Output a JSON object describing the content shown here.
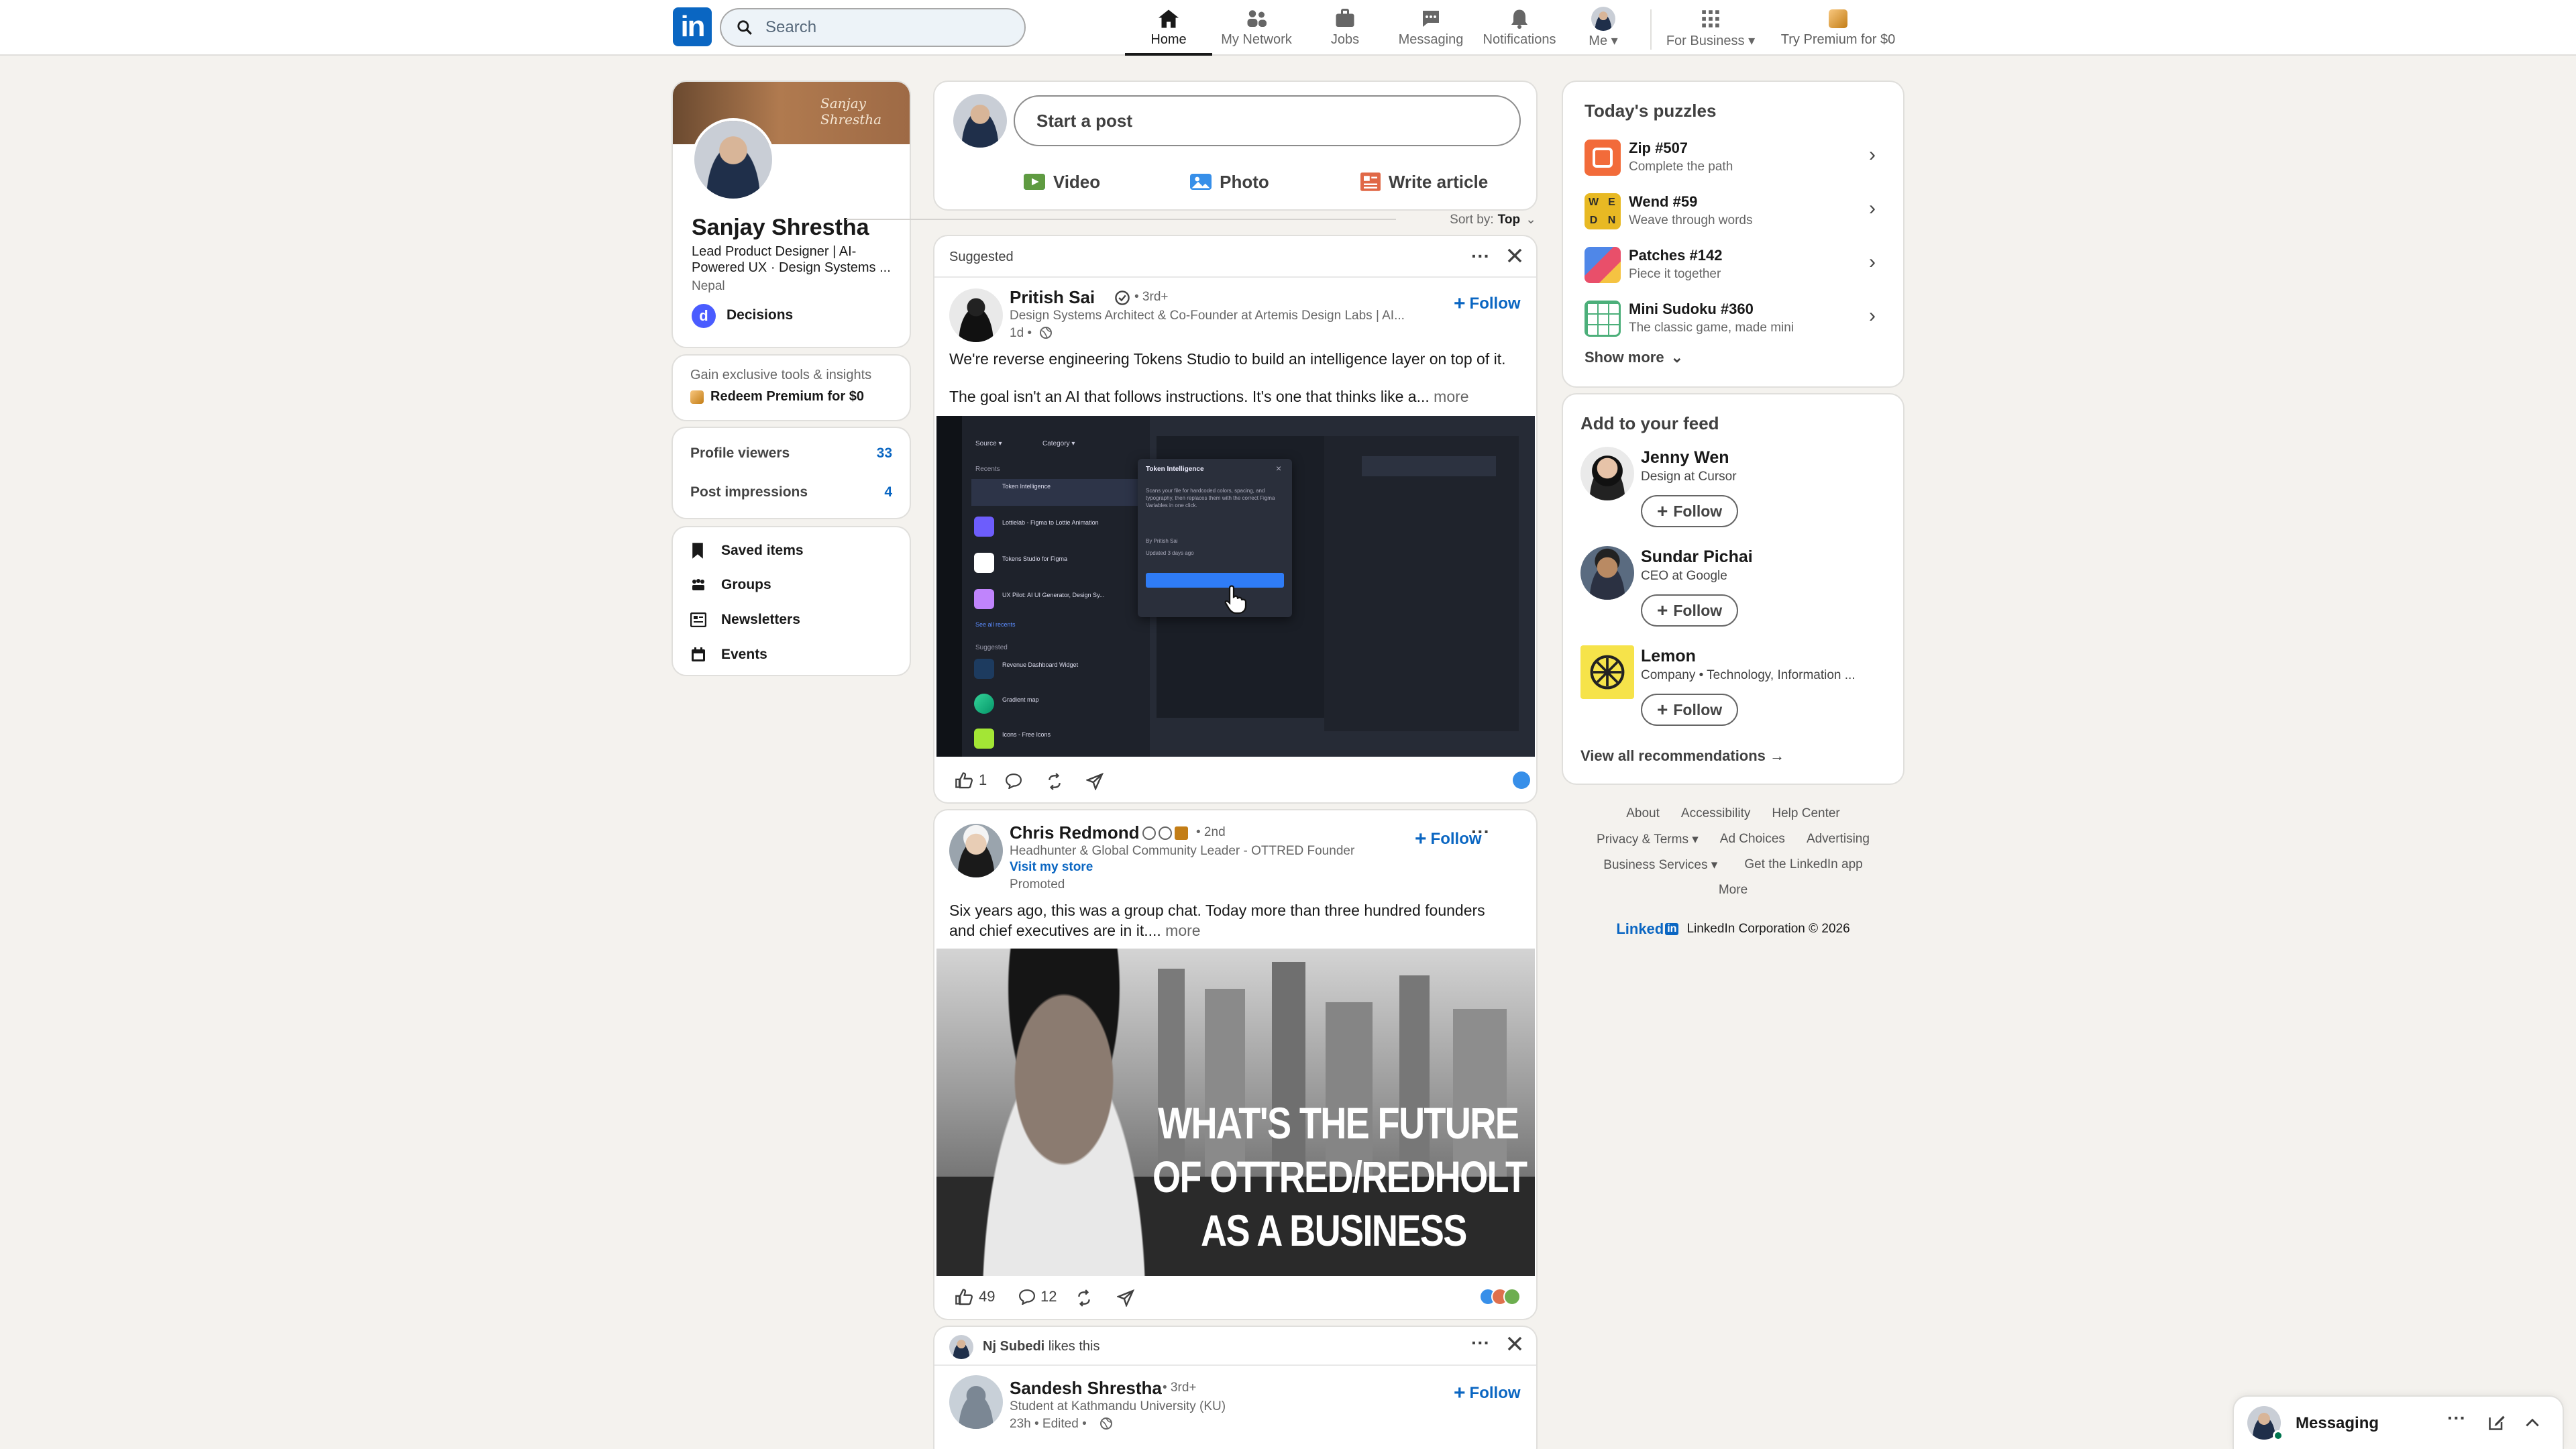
{
  "nav": {
    "logo": "in",
    "search_placeholder": "Search",
    "items": [
      {
        "label": "Home"
      },
      {
        "label": "My Network"
      },
      {
        "label": "Jobs"
      },
      {
        "label": "Messaging"
      },
      {
        "label": "Notifications"
      },
      {
        "label": "Me ▾"
      },
      {
        "label": "For Business ▾"
      },
      {
        "label": "Try Premium for $0"
      }
    ]
  },
  "profile": {
    "name": "Sanjay Shrestha",
    "headline_1": "Lead Product Designer | AI-",
    "headline_2": "Powered UX · Design Systems ...",
    "location": "Nepal",
    "org_badge": "d",
    "org": "Decisions",
    "banner_text": "Sanjay Shrestha",
    "premium_hint": "Gain exclusive tools & insights",
    "premium_cta": "Redeem Premium for $0",
    "stats": [
      {
        "label": "Profile viewers",
        "value": "33"
      },
      {
        "label": "Post impressions",
        "value": "4"
      }
    ],
    "links": [
      {
        "label": "Saved items"
      },
      {
        "label": "Groups"
      },
      {
        "label": "Newsletters"
      },
      {
        "label": "Events"
      }
    ]
  },
  "composer": {
    "placeholder": "Start a post",
    "actions": [
      {
        "label": "Video"
      },
      {
        "label": "Photo"
      },
      {
        "label": "Write article"
      }
    ],
    "sort_label": "Sort by:",
    "sort_value": "Top"
  },
  "post1": {
    "context": "Suggested",
    "author": "Pritish Sai",
    "degree": "• 3rd+",
    "headline": "Design Systems Architect & Co-Founder at Artemis Design Labs | AI...",
    "time": "1d •",
    "follow": "Follow",
    "text_1": "We're reverse engineering Tokens Studio to build an intelligence layer on top of it.",
    "text_2": "The goal isn't an AI that follows instructions. It's one that thinks like a...",
    "more": "more",
    "likes": "1",
    "ui": {
      "source": "Source",
      "category": "Category",
      "recents": "Recents",
      "suggested": "Suggested",
      "see_all": "See all recents",
      "items": [
        "Token Intelligence",
        "Lottielab - Figma to Lottie Animation",
        "Tokens Studio for Figma",
        "UX Pilot: AI UI Generator, Design Sy..."
      ],
      "suggested_items": [
        "Revenue Dashboard Widget",
        "Gradient map",
        "Icons - Free Icons"
      ],
      "panel_title": "Token Intelligence",
      "panel_desc": "Scans your file for hardcoded colors, spacing, and typography, then replaces them with the correct Figma Variables in one click.",
      "panel_meta_1": "By Pritish Sai",
      "panel_meta_2": "Updated 3 days ago"
    }
  },
  "post2": {
    "author": "Chris Redmond",
    "degree": "• 2nd",
    "headline": "Headhunter & Global Community Leader - OTTRED Founder",
    "store": "Visit my store",
    "promoted": "Promoted",
    "follow": "Follow",
    "text_1": "Six years ago, this was a group chat. Today more than three hundred founders",
    "text_2": "and chief executives are in it....",
    "more": "more",
    "overlay_1": "WHAT'S THE FUTURE",
    "overlay_2": "OF OTTRED/REDHOLT",
    "overlay_3": "AS A BUSINESS",
    "likes": "49",
    "comments": "12"
  },
  "post3": {
    "liker": "Nj Subedi",
    "liker_suffix": "likes this",
    "author": "Sandesh Shrestha",
    "degree": "• 3rd+",
    "headline": "Student at Kathmandu University (KU)",
    "time": "23h • Edited •",
    "follow": "Follow"
  },
  "puzzles": {
    "title": "Today's puzzles",
    "items": [
      {
        "name": "Zip #507",
        "desc": "Complete the path"
      },
      {
        "name": "Wend #59",
        "desc": "Weave through words"
      },
      {
        "name": "Patches #142",
        "desc": "Piece it together"
      },
      {
        "name": "Mini Sudoku #360",
        "desc": "The classic game, made mini"
      }
    ],
    "show_more": "Show more"
  },
  "feed_suggest": {
    "title": "Add to your feed",
    "people": [
      {
        "name": "Jenny Wen",
        "desc": "Design at Cursor",
        "follow": "Follow"
      },
      {
        "name": "Sundar Pichai",
        "desc": "CEO at Google",
        "follow": "Follow"
      },
      {
        "name": "Lemon",
        "desc": "Company • Technology, Information ...",
        "follow": "Follow"
      }
    ],
    "view_all": "View all recommendations →"
  },
  "footer": {
    "links_row1": [
      "About",
      "Accessibility",
      "Help Center"
    ],
    "links_row2": [
      "Privacy & Terms ▾",
      "Ad Choices",
      "Advertising"
    ],
    "links_row3": [
      "Business Services ▾",
      "Get the LinkedIn app"
    ],
    "more": "More",
    "brand": "Linked",
    "brand_in": "in",
    "copyright": "LinkedIn Corporation © 2026"
  },
  "messaging": {
    "label": "Messaging"
  },
  "colors": {
    "brand": "#0a66c2",
    "bg": "#f4f2ee"
  }
}
